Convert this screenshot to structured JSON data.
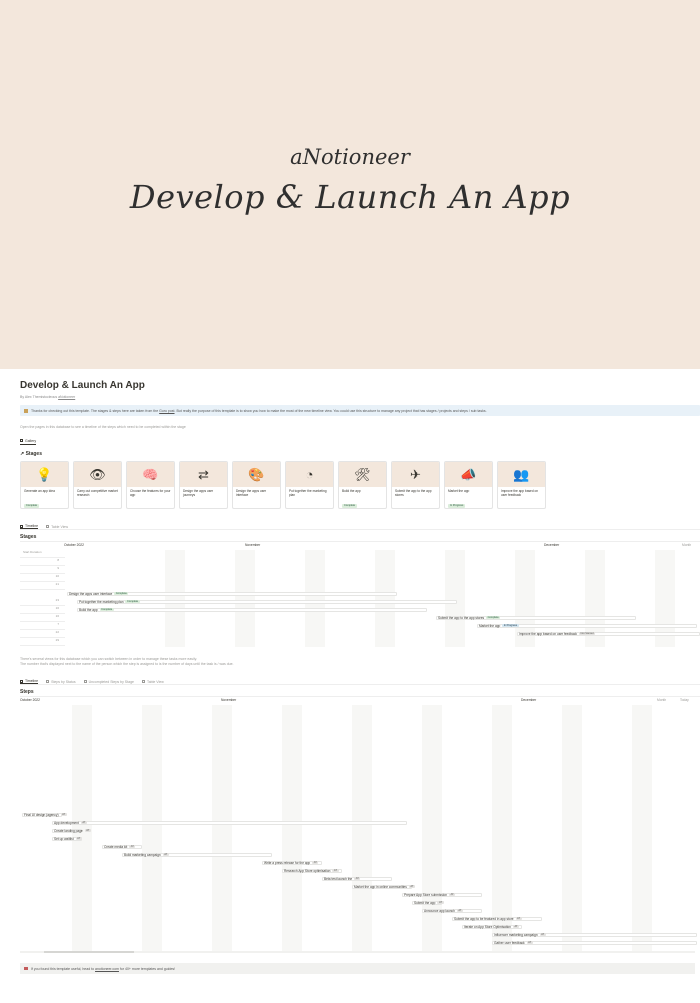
{
  "cover": {
    "brand": "aNotioneer",
    "title": "Develop & Launch An App"
  },
  "page": {
    "title": "Develop & Launch An App",
    "byline_prefix": "By",
    "byline_author": "Alex Themistocleous",
    "byline_handle": "aNotioneer",
    "callout": "Thanks for checking out this template. The stages & steps here are taken from the",
    "callout_link": "Guru post",
    "callout_rest": ". But really the purpose of this template is to show you how to make the most of the new timeline view. You could use this structure to manage any project that has stages / projects and steps / sub tasks.",
    "intro": "Open the pages in this database to see a timeline of the steps which need to be completed within the stage",
    "gallery_tab": "Gallery",
    "stages_heading": "Stages"
  },
  "stage_cards": [
    {
      "label": "Generate an app idea",
      "status": "Complete",
      "icon": "lightbulb-icon",
      "glyph": "💡"
    },
    {
      "label": "Carry out competitive market research",
      "status": "Complete",
      "icon": "eye-icon",
      "glyph": "👁"
    },
    {
      "label": "Choose the features for your app",
      "status": "Complete",
      "icon": "head-icon",
      "glyph": "🧠"
    },
    {
      "label": "Design the apps user journeys",
      "status": "Complete",
      "icon": "arrows-icon",
      "glyph": "⇄"
    },
    {
      "label": "Design the apps user interface",
      "status": "Complete",
      "icon": "palette-icon",
      "glyph": "🎨"
    },
    {
      "label": "Put together the marketing plan",
      "status": "Complete",
      "icon": "pie-chart-icon",
      "glyph": "◔"
    },
    {
      "label": "Build the app",
      "status": "Complete",
      "icon": "tools-icon",
      "glyph": "🛠"
    },
    {
      "label": "Submit the app to the app stores",
      "status": "Complete",
      "icon": "paper-plane-icon",
      "glyph": "✈"
    },
    {
      "label": "Market the app",
      "status": "In Progress",
      "icon": "megaphone-icon",
      "glyph": "📣"
    },
    {
      "label": "Improve the app based on user feedback",
      "status": "Not Started",
      "icon": "people-icon",
      "glyph": "👥"
    }
  ],
  "stages_timeline": {
    "tabs": [
      "Timeline",
      "Table View"
    ],
    "heading": "Stages",
    "months": [
      "October 2022",
      "November",
      "December"
    ],
    "view_mode": "Month",
    "col_header": "Start Duration",
    "row_values": [
      "8",
      "9",
      "10",
      "21",
      "23",
      "16",
      "16",
      "7",
      "22",
      "29"
    ],
    "bars": [
      {
        "label": "Design the apps user interface",
        "status": "Complete"
      },
      {
        "label": "Put together the marketing plan",
        "status": "Complete"
      },
      {
        "label": "Build the app",
        "status": "Complete"
      },
      {
        "label": "Submit the app to the app stores",
        "status": "Complete"
      },
      {
        "label": "Market the app",
        "status": "In Progress"
      },
      {
        "label": "Improve the app based on user feedback",
        "status": "Not Started"
      }
    ]
  },
  "steps_intro": {
    "line1": "There's several views for this database which you can switch between in order to manage these tasks more easily.",
    "line2": "The number that's displayed next to the name of the person which the step is assigned to is the number of days until the task is / was due."
  },
  "steps_timeline": {
    "tabs": [
      "Timeline",
      "Steps by Status",
      "Uncompleted Steps by Stage",
      "Table View"
    ],
    "heading": "Steps",
    "months": [
      "October 2022",
      "November",
      "December"
    ],
    "view_mode": "Month",
    "today": "Today",
    "bars": [
      {
        "label": "Final UI design (agency)",
        "tag": "AT"
      },
      {
        "label": "App development",
        "tag": "AT"
      },
      {
        "label": "Create landing page",
        "tag": "AT"
      },
      {
        "label": "Set up waitlist",
        "tag": "AT"
      },
      {
        "label": "Create media kit",
        "tag": "AT"
      },
      {
        "label": "Build marketing campaign",
        "tag": "AT"
      },
      {
        "label": "Write a press release for the app",
        "tag": "AT"
      },
      {
        "label": "Research App Store optimisation",
        "tag": "AT"
      },
      {
        "label": "Beta test launch the",
        "tag": "AT"
      },
      {
        "label": "Market the app in online communities",
        "tag": "AT"
      },
      {
        "label": "Prepare App Store submission",
        "tag": "AT"
      },
      {
        "label": "Submit the app",
        "tag": "AT"
      },
      {
        "label": "Announce app launch",
        "tag": "AT"
      },
      {
        "label": "Submit the app to be featured in app store",
        "tag": "AT"
      },
      {
        "label": "Iterate on App Store Optimisation",
        "tag": "AT"
      },
      {
        "label": "Influencer marketing campaign",
        "tag": "AT"
      },
      {
        "label": "Gather user feedback",
        "tag": "AT"
      }
    ]
  },
  "footer": {
    "text": "If you found this template useful, head to",
    "link": "anotioneer.com",
    "rest": "for 40+ more templates and guides!"
  }
}
